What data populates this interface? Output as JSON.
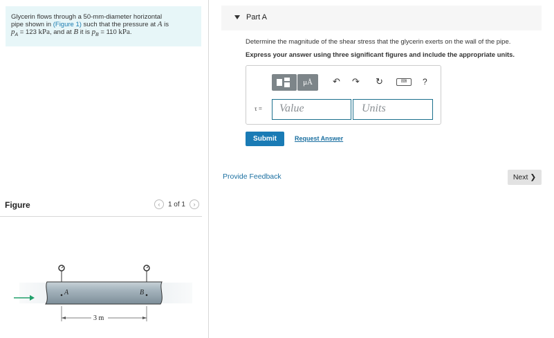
{
  "problem": {
    "line1": "Glycerin flows through a 50-mm-diameter horizontal",
    "line2_pre": "pipe shown in ",
    "figure_link": "(Figure 1)",
    "line2_post": " such that the pressure at ",
    "point_a": "A",
    "line2_end": " is",
    "pa_sym": "p",
    "pa_sub": "A",
    "pa_val": " = 123 ",
    "pa_unit": "kPa",
    "line3_mid": ", and at ",
    "point_b": "B",
    "line3_it": " it is ",
    "pb_sym": "p",
    "pb_sub": "B",
    "pb_val": " = 110 ",
    "pb_unit": "kPa",
    "period": "."
  },
  "figure": {
    "title": "Figure",
    "prev_icon": "chevron-left-icon",
    "next_icon": "chevron-right-icon",
    "pager": "1 of 1",
    "label_a": "A",
    "label_b": "B",
    "dimension": "3 m"
  },
  "part": {
    "label": "Part A",
    "question": "Determine the magnitude of the shear stress that the glycerin exerts on the wall of the pipe.",
    "instruction": "Express your answer using three significant figures and include the appropriate units."
  },
  "answer": {
    "tau_label": "τ =",
    "value_placeholder": "Value",
    "units_placeholder": "Units",
    "toolbar_mu": "μÅ",
    "help": "?"
  },
  "buttons": {
    "submit": "Submit",
    "request_answer": "Request Answer",
    "provide_feedback": "Provide Feedback",
    "next": "Next ❯"
  },
  "colors": {
    "accent": "#1a7bb5",
    "link": "#1a6fa0",
    "problem_bg": "#e7f6f8",
    "toolbar_bg": "#7d8589",
    "arrow": "#22a06b"
  }
}
